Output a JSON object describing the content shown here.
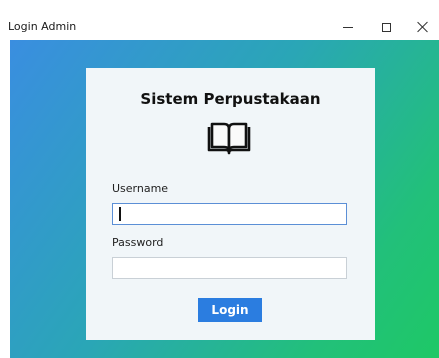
{
  "window": {
    "title": "Login Admin",
    "controls": {
      "minimize": "minimize-icon",
      "maximize": "maximize-icon",
      "close": "close-icon"
    }
  },
  "login": {
    "heading": "Sistem Perpustakaan",
    "icon": "book-icon",
    "username_label": "Username",
    "username_value": "",
    "password_label": "Password",
    "password_value": "",
    "button_label": "Login"
  },
  "colors": {
    "gradient_start": "#3a8ee0",
    "gradient_end": "#1ec866",
    "button": "#2b7de0",
    "card": "#f1f6f9"
  }
}
